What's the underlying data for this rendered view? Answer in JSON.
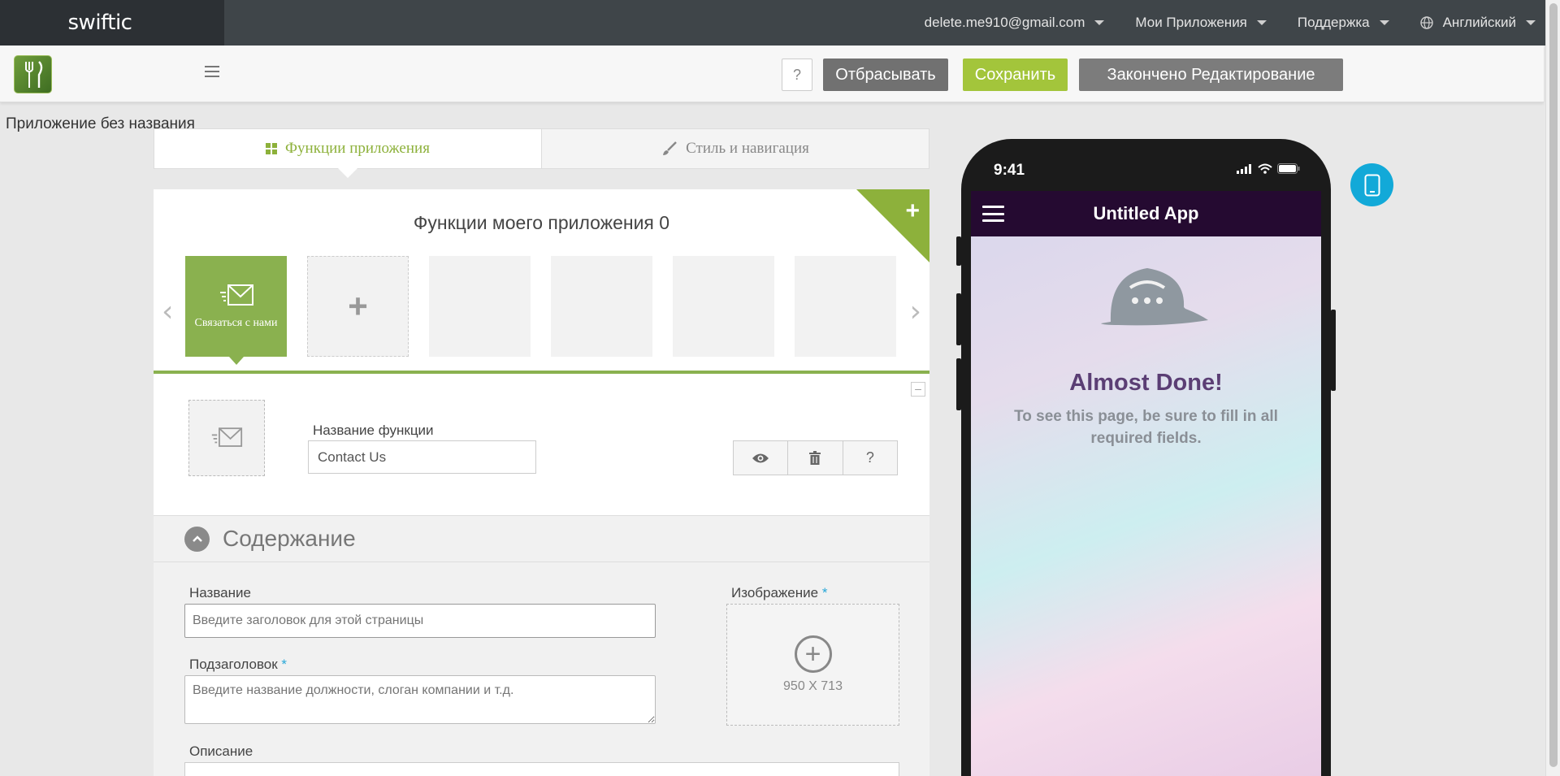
{
  "topbar": {
    "logo": "swiftic",
    "email": "delete.me910@gmail.com",
    "my_apps": "Мои Приложения",
    "support": "Поддержка",
    "language": "Английский"
  },
  "toolbar": {
    "help": "?",
    "discard": "Отбрасывать",
    "save": "Сохранить",
    "done": "Закончено Редактирование"
  },
  "app_name": "Приложение без названия",
  "tabs": {
    "features": "Функции приложения",
    "style": "Стиль и навигация"
  },
  "features": {
    "title": "Функции моего приложения 0",
    "tiles": [
      "Связаться с нами"
    ]
  },
  "detail": {
    "name_label": "Название функции",
    "name_value": "Contact Us"
  },
  "content": {
    "section_title": "Содержание",
    "title_label": "Название",
    "title_placeholder": "Введите заголовок для этой страницы",
    "subtitle_label": "Подзаголовок",
    "subtitle_placeholder": "Введите название должности, слоган компании и т.д.",
    "image_label": "Изображение",
    "image_size": "950 X 713",
    "description_label": "Описание",
    "required_mark": "*"
  },
  "phone": {
    "time": "9:41",
    "app_title": "Untitled App",
    "heading": "Almost Done!",
    "message": "To see this page, be sure to fill in all required fields."
  },
  "colors": {
    "accent_green": "#8db13b",
    "save_green": "#a3c53b",
    "app_header": "#250a31",
    "device_toggle": "#12a9d8"
  }
}
